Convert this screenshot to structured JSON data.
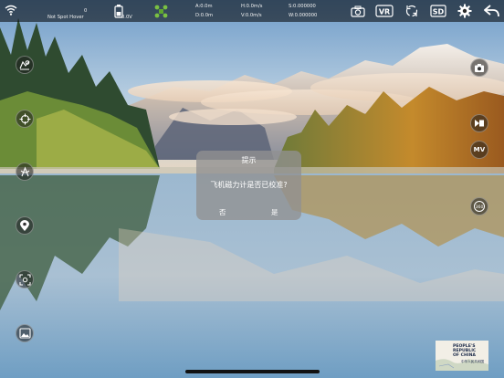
{
  "top_bar": {
    "wifi_icon": "wifi-icon",
    "flight_mode": "Not Spot Hover",
    "counter": "0",
    "battery_value": "0.0V",
    "altitude": "A:0.0m",
    "distance": "D:0.0m",
    "h_speed": "H:0.0m/s",
    "v_speed": "V:0.0m/s",
    "satellites_s": "S:0.000000",
    "satellites_w": "W:0.000000",
    "buttons": {
      "camera": "camera-icon",
      "vr": "VR",
      "rotate": "rotate-icon",
      "sd": "SD",
      "settings": "gear-icon",
      "back": "back-arrow-icon"
    }
  },
  "left_tools": [
    "map-pin-icon",
    "crosshair-icon",
    "calibrate-icon",
    "location-icon",
    "focus-icon",
    "gallery-icon"
  ],
  "right_tools": {
    "photo": "camera-icon",
    "video": "video-icon",
    "mv_label": "MV",
    "rotate360": "360-icon",
    "rotate360_label": "360"
  },
  "dialog": {
    "title": "提示",
    "message": "飞机磁力计是否已校准?",
    "no_label": "否",
    "yes_label": "是"
  },
  "map_thumb": {
    "line1": "PEOPLE'S",
    "line2": "REPUBLIC",
    "line3": "OF CHINA",
    "sub": "中华人民共和国"
  },
  "colors": {
    "topbar": "#000000",
    "dialog": "#919191",
    "sky": "#8fb3d6",
    "lake": "#7fa8c7",
    "pine": "#2b4a2c"
  }
}
